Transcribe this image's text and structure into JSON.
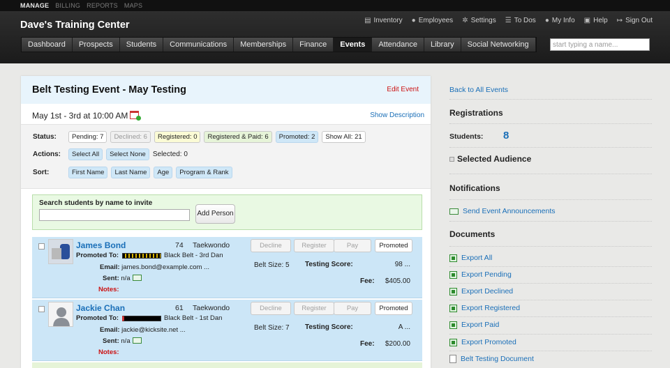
{
  "topbar": [
    "MANAGE",
    "BILLING",
    "REPORTS",
    "MAPS"
  ],
  "brand": "Dave's Training Center",
  "utilnav": [
    {
      "label": "Inventory",
      "icon": "clipboard-icon"
    },
    {
      "label": "Employees",
      "icon": "people-icon"
    },
    {
      "label": "Settings",
      "icon": "gear-icon"
    },
    {
      "label": "To Dos",
      "icon": "list-icon"
    },
    {
      "label": "My Info",
      "icon": "person-icon"
    },
    {
      "label": "Help",
      "icon": "help-icon"
    },
    {
      "label": "Sign Out",
      "icon": "signout-icon"
    }
  ],
  "mainnav": [
    "Dashboard",
    "Prospects",
    "Students",
    "Communications",
    "Memberships",
    "Finance",
    "Events",
    "Attendance",
    "Library",
    "Social Networking"
  ],
  "mainnav_active": "Events",
  "name_search_placeholder": "start typing a name...",
  "event": {
    "title": "Belt Testing Event - May Testing",
    "edit": "Edit Event",
    "date": "May 1st - 3rd at 10:00 AM",
    "show_description": "Show Description"
  },
  "controls": {
    "status_label": "Status:",
    "statuses": [
      "Pending: 7",
      "Declined: 6",
      "Registered: 0",
      "Registered & Paid: 6",
      "Promoted: 2",
      "Show All: 21"
    ],
    "actions_label": "Actions:",
    "select_all": "Select All",
    "select_none": "Select None",
    "selected": "Selected: 0",
    "sort_label": "Sort:",
    "sorts": [
      "First Name",
      "Last Name",
      "Age",
      "Program & Rank"
    ]
  },
  "invite": {
    "label": "Search students by name to invite",
    "button": "Add Person"
  },
  "students": [
    {
      "name": "James Bond",
      "age": "74",
      "program": "Taekwondo",
      "promoted_label": "Promoted To:",
      "rank": "Black Belt - 3rd Dan",
      "email_label": "Email:",
      "email": "james.bond@example.com ...",
      "sent_label": "Sent:",
      "sent": "n/a",
      "notes_label": "Notes:",
      "buttons": [
        "Decline",
        "Register",
        "Pay",
        "Promoted"
      ],
      "belt_size_label": "Belt Size:",
      "belt_size": "5",
      "score_label": "Testing Score:",
      "score": "98 ...",
      "fee_label": "Fee:",
      "fee": "$405.00"
    },
    {
      "name": "Jackie Chan",
      "age": "61",
      "program": "Taekwondo",
      "promoted_label": "Promoted To:",
      "rank": "Black Belt - 1st Dan",
      "email_label": "Email:",
      "email": "jackie@kicksite.net ...",
      "sent_label": "Sent:",
      "sent": "n/a",
      "notes_label": "Notes:",
      "buttons": [
        "Decline",
        "Register",
        "Pay",
        "Promoted"
      ],
      "belt_size_label": "Belt Size:",
      "belt_size": "7",
      "score_label": "Testing Score:",
      "score": "A ...",
      "fee_label": "Fee:",
      "fee": "$200.00"
    }
  ],
  "sidebar": {
    "back": "Back to All Events",
    "registrations": "Registrations",
    "students_label": "Students:",
    "students_count": "8",
    "selected_audience": "Selected Audience",
    "notifications": "Notifications",
    "send_announcements": "Send Event Announcements",
    "documents": "Documents",
    "docs": [
      "Export All",
      "Export Pending",
      "Export Declined",
      "Export Registered",
      "Export Paid",
      "Export Promoted",
      "Belt Testing Document"
    ]
  },
  "colors": {
    "link": "#1a6fb8",
    "accent_red": "#cc1111",
    "row_blue": "#cce6f7"
  }
}
